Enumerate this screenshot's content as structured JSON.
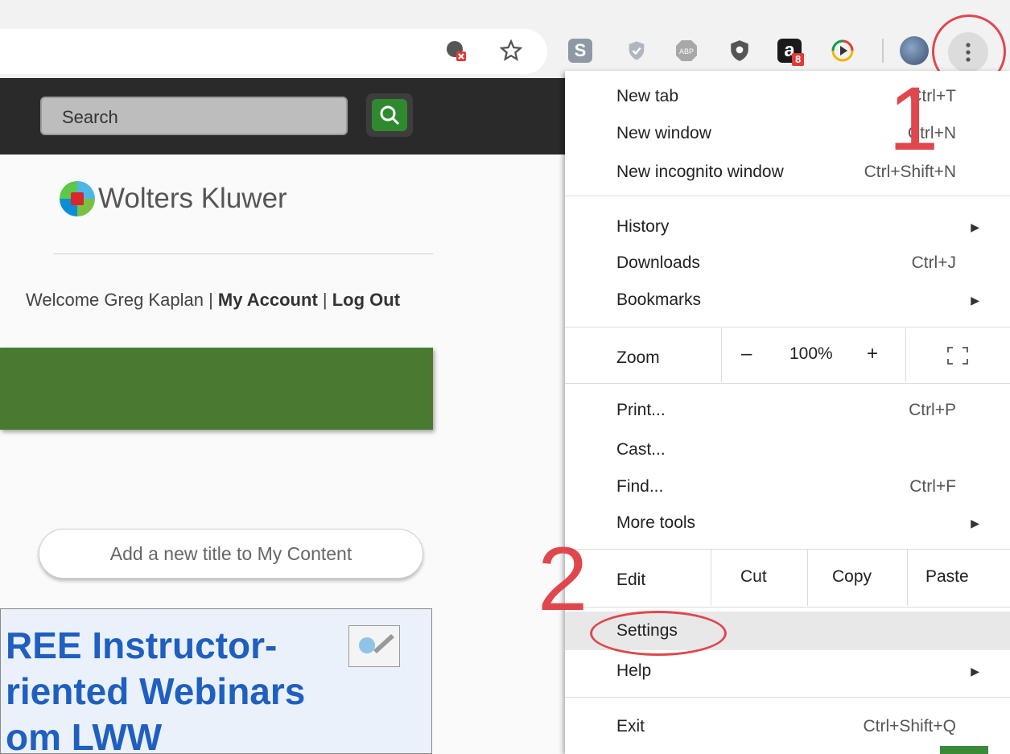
{
  "toolbar": {
    "icons": [
      "translate-icon",
      "star-icon",
      "scribd-icon",
      "shield-check-icon",
      "adblock-plus-icon",
      "privacy-shield-icon",
      "amazon-icon",
      "media-play-icon"
    ],
    "amazon_badge": "8",
    "adblock_label": "ABP"
  },
  "site": {
    "search_placeholder": "Search",
    "logo_text": "Wolters Kluwer",
    "welcome_text": "Welcome Greg Kaplan",
    "sep": "|",
    "my_account": "My Account",
    "log_out": "Log Out",
    "add_title_button": "Add a new title to My Content",
    "promo_lines": [
      "REE Instructor-",
      "riented Webinars",
      "om LWW"
    ]
  },
  "menu": {
    "new_tab": {
      "label": "New tab",
      "shortcut": "Ctrl+T"
    },
    "new_window": {
      "label": "New window",
      "shortcut": "Ctrl+N"
    },
    "new_incognito": {
      "label": "New incognito window",
      "shortcut": "Ctrl+Shift+N"
    },
    "history": {
      "label": "History"
    },
    "downloads": {
      "label": "Downloads",
      "shortcut": "Ctrl+J"
    },
    "bookmarks": {
      "label": "Bookmarks"
    },
    "zoom": {
      "label": "Zoom",
      "minus": "–",
      "value": "100%",
      "plus": "+"
    },
    "print": {
      "label": "Print...",
      "shortcut": "Ctrl+P"
    },
    "cast": {
      "label": "Cast..."
    },
    "find": {
      "label": "Find...",
      "shortcut": "Ctrl+F"
    },
    "more_tools": {
      "label": "More tools"
    },
    "edit": {
      "label": "Edit",
      "cut": "Cut",
      "copy": "Copy",
      "paste": "Paste"
    },
    "settings": {
      "label": "Settings"
    },
    "help": {
      "label": "Help"
    },
    "exit": {
      "label": "Exit",
      "shortcut": "Ctrl+Shift+Q"
    }
  },
  "annotations": {
    "step1": "1",
    "step2": "2"
  },
  "colors": {
    "annotation_red": "#e0474c",
    "banner_green": "#4a7a32",
    "promo_blue": "#1f5fbf"
  }
}
